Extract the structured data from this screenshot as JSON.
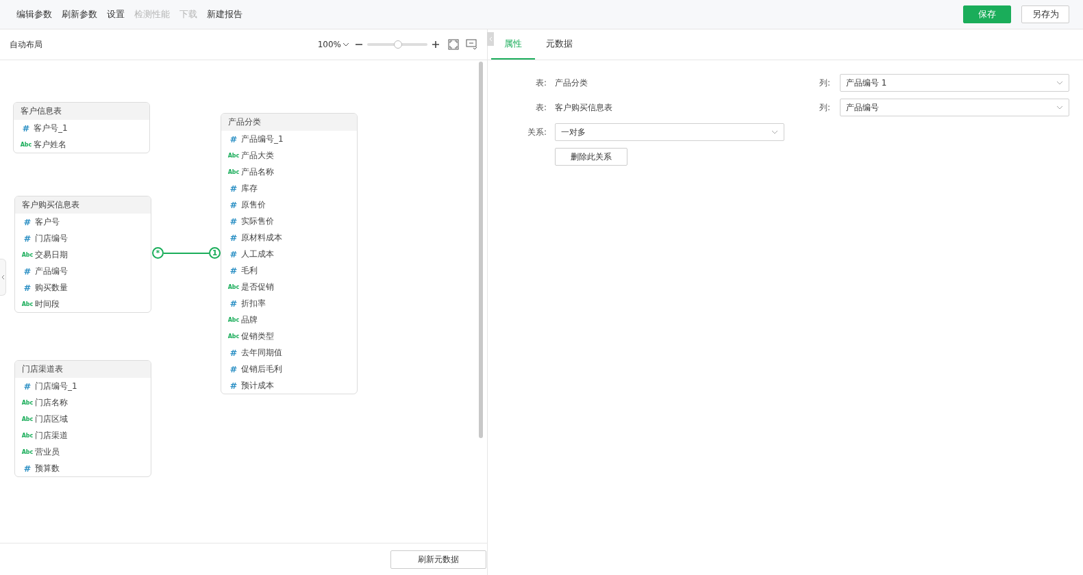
{
  "menu": [
    {
      "label": "编辑参数",
      "disabled": false
    },
    {
      "label": "刷新参数",
      "disabled": false
    },
    {
      "label": "设置",
      "disabled": false
    },
    {
      "label": "检测性能",
      "disabled": true
    },
    {
      "label": "下载",
      "disabled": true
    },
    {
      "label": "新建报告",
      "disabled": false
    }
  ],
  "actions": [
    {
      "label": "保存",
      "kind": "primary"
    },
    {
      "label": "另存为",
      "kind": "secondary"
    }
  ],
  "canvas_toolbar": {
    "layout_label": "自动布局",
    "zoom": "100%",
    "zoom_slider": {
      "level": 0.51
    }
  },
  "tables": [
    {
      "title": "客户信息表",
      "fields": [
        {
          "kind": "number",
          "glyph": "#",
          "name": "客户号_1"
        },
        {
          "kind": "text",
          "glyph": "Abc",
          "name": "客户姓名"
        }
      ]
    },
    {
      "title": "客户购买信息表",
      "fields": [
        {
          "kind": "number",
          "glyph": "#",
          "name": "客户号"
        },
        {
          "kind": "number",
          "glyph": "#",
          "name": "门店编号"
        },
        {
          "kind": "text",
          "glyph": "Abc",
          "name": "交易日期"
        },
        {
          "kind": "number",
          "glyph": "#",
          "name": "产品编号"
        },
        {
          "kind": "number",
          "glyph": "#",
          "name": "购买数量"
        },
        {
          "kind": "text",
          "glyph": "Abc",
          "name": "时间段"
        }
      ]
    },
    {
      "title": "门店渠道表",
      "fields": [
        {
          "kind": "number",
          "glyph": "#",
          "name": "门店编号_1"
        },
        {
          "kind": "text",
          "glyph": "Abc",
          "name": "门店名称"
        },
        {
          "kind": "text",
          "glyph": "Abc",
          "name": "门店区域"
        },
        {
          "kind": "text",
          "glyph": "Abc",
          "name": "门店渠道"
        },
        {
          "kind": "text",
          "glyph": "Abc",
          "name": "营业员"
        },
        {
          "kind": "number",
          "glyph": "#",
          "name": "预算数"
        }
      ]
    },
    {
      "title": "产品分类",
      "fields": [
        {
          "kind": "number",
          "glyph": "#",
          "name": "产品编号_1"
        },
        {
          "kind": "text",
          "glyph": "Abc",
          "name": "产品大类"
        },
        {
          "kind": "text",
          "glyph": "Abc",
          "name": "产品名称"
        },
        {
          "kind": "number",
          "glyph": "#",
          "name": "库存"
        },
        {
          "kind": "number",
          "glyph": "#",
          "name": "原售价"
        },
        {
          "kind": "number",
          "glyph": "#",
          "name": "实际售价"
        },
        {
          "kind": "number",
          "glyph": "#",
          "name": "原材料成本"
        },
        {
          "kind": "number",
          "glyph": "#",
          "name": "人工成本"
        },
        {
          "kind": "number",
          "glyph": "#",
          "name": "毛利"
        },
        {
          "kind": "text",
          "glyph": "Abc",
          "name": "是否促销"
        },
        {
          "kind": "number",
          "glyph": "#",
          "name": "折扣率"
        },
        {
          "kind": "text",
          "glyph": "Abc",
          "name": "品牌"
        },
        {
          "kind": "text",
          "glyph": "Abc",
          "name": "促销类型"
        },
        {
          "kind": "number",
          "glyph": "#",
          "name": "去年同期值"
        },
        {
          "kind": "number",
          "glyph": "#",
          "name": "促销后毛利"
        },
        {
          "kind": "number",
          "glyph": "#",
          "name": "预计成本"
        }
      ]
    }
  ],
  "relation": {
    "from_marker": "*",
    "to_marker": "1"
  },
  "refresh_button": "刷新元数据",
  "tabs": [
    {
      "label": "属性",
      "selected": true
    },
    {
      "label": "元数据",
      "selected": false
    }
  ],
  "properties": {
    "rows": [
      {
        "table_label": "表:",
        "table": "产品分类",
        "column_label": "列:",
        "column": "产品编号 1"
      },
      {
        "table_label": "表:",
        "table": "客户购买信息表",
        "column_label": "列:",
        "column": "产品编号"
      }
    ],
    "relation_label": "关系:",
    "relation_value": "一对多",
    "delete_button": "删除此关系"
  }
}
